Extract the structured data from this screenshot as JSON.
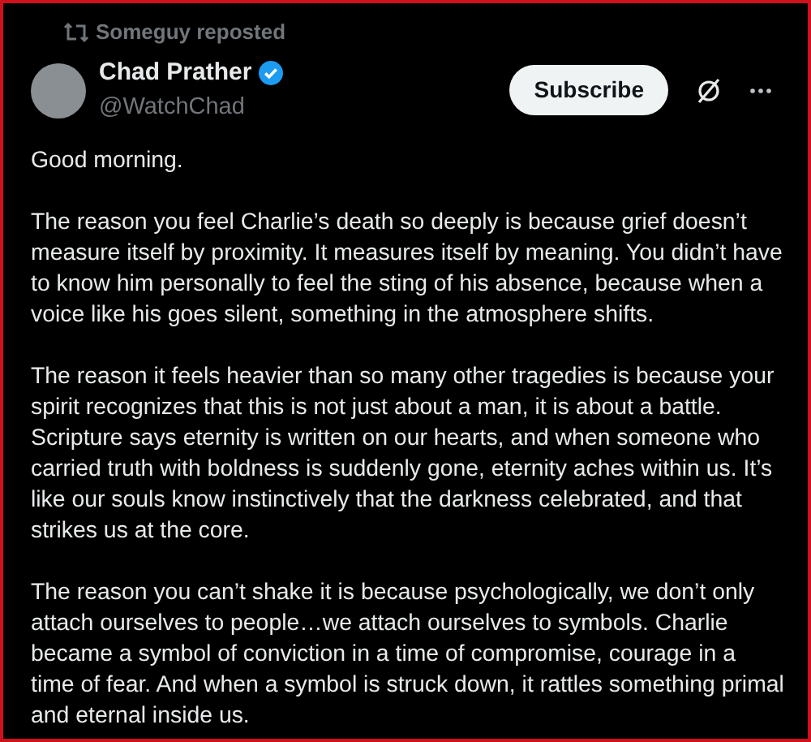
{
  "repost_line": {
    "text": "Someguy reposted"
  },
  "author": {
    "name": "Chad Prather",
    "handle": "@WatchChad",
    "verified": true
  },
  "subscribe_button": {
    "label": "Subscribe"
  },
  "paragraphs": [
    "Good morning.",
    "The reason you feel Charlie’s death so deeply is because grief doesn’t measure itself by proximity. It measures itself by meaning. You didn’t have to know him personally to feel the sting of his absence, because when a voice like his goes silent, something in the atmosphere shifts.",
    "The reason it feels heavier than so many other tragedies is because your spirit recognizes that this is not just about a man, it is about a battle. Scripture says eternity is written on our hearts, and when someone who carried truth with boldness is suddenly gone, eternity aches within us. It’s like our souls know instinctively that the darkness celebrated, and that strikes us at the core.",
    "The reason you can’t shake it is because psychologically, we don’t only attach ourselves to people…we attach ourselves to symbols. Charlie became a symbol of conviction in a time of compromise, courage in a time of fear. And when a symbol is struck down, it rattles something primal and eternal inside us."
  ]
}
